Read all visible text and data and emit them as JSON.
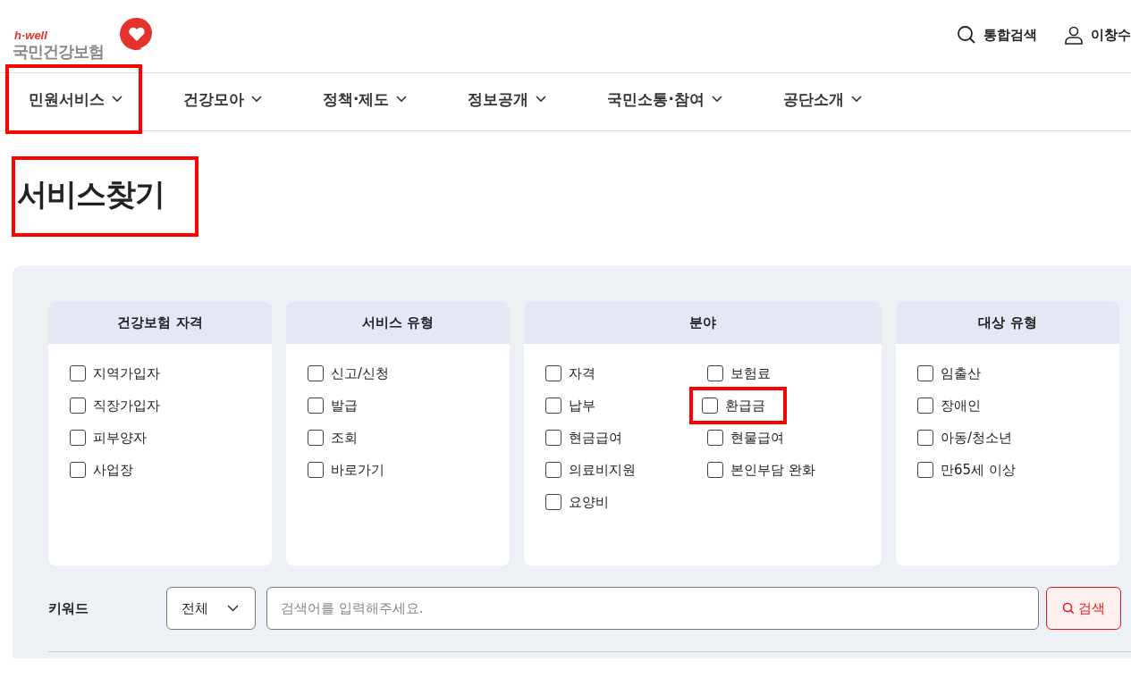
{
  "logo": {
    "tagline": "h·well",
    "name": "국민건강보험"
  },
  "header_actions": [
    {
      "kind": "search",
      "label": "통합검색"
    },
    {
      "kind": "user",
      "label": "이창수"
    }
  ],
  "nav": [
    {
      "label": "민원서비스",
      "highlighted": true
    },
    {
      "label": "건강모아",
      "highlighted": false
    },
    {
      "label": "정책·제도",
      "highlighted": false
    },
    {
      "label": "정보공개",
      "highlighted": false
    },
    {
      "label": "국민소통·참여",
      "highlighted": false
    },
    {
      "label": "공단소개",
      "highlighted": false
    }
  ],
  "page_title": {
    "text": "서비스찾기",
    "highlighted": true
  },
  "filters": [
    {
      "title": "건강보험 자격",
      "kind": "single",
      "options": [
        {
          "label": "지역가입자",
          "checked": false,
          "highlighted": false
        },
        {
          "label": "직장가입자",
          "checked": false,
          "highlighted": false
        },
        {
          "label": "피부양자",
          "checked": false,
          "highlighted": false
        },
        {
          "label": "사업장",
          "checked": false,
          "highlighted": false
        }
      ]
    },
    {
      "title": "서비스 유형",
      "kind": "single",
      "options": [
        {
          "label": "신고/신청",
          "checked": false,
          "highlighted": false
        },
        {
          "label": "발급",
          "checked": false,
          "highlighted": false
        },
        {
          "label": "조회",
          "checked": false,
          "highlighted": false
        },
        {
          "label": "바로가기",
          "checked": false,
          "highlighted": false
        }
      ]
    },
    {
      "title": "분야",
      "kind": "double",
      "options": [
        {
          "label": "자격",
          "checked": false,
          "highlighted": false
        },
        {
          "label": "보험료",
          "checked": false,
          "highlighted": false
        },
        {
          "label": "납부",
          "checked": false,
          "highlighted": false
        },
        {
          "label": "환급금",
          "checked": false,
          "highlighted": true
        },
        {
          "label": "현금급여",
          "checked": false,
          "highlighted": false
        },
        {
          "label": "현물급여",
          "checked": false,
          "highlighted": false
        },
        {
          "label": "의료비지원",
          "checked": false,
          "highlighted": false
        },
        {
          "label": "본인부담 완화",
          "checked": false,
          "highlighted": false
        },
        {
          "label": "요양비",
          "checked": false,
          "highlighted": false
        }
      ]
    },
    {
      "title": "대상 유형",
      "kind": "single",
      "options": [
        {
          "label": "임출산",
          "checked": false,
          "highlighted": false
        },
        {
          "label": "장애인",
          "checked": false,
          "highlighted": false
        },
        {
          "label": "아동/청소년",
          "checked": false,
          "highlighted": false
        },
        {
          "label": "만65세 이상",
          "checked": false,
          "highlighted": false
        }
      ]
    }
  ],
  "keyword": {
    "label": "키워드",
    "scope": "전체",
    "placeholder": "검색어를 입력해주세요.",
    "button": "검색"
  }
}
